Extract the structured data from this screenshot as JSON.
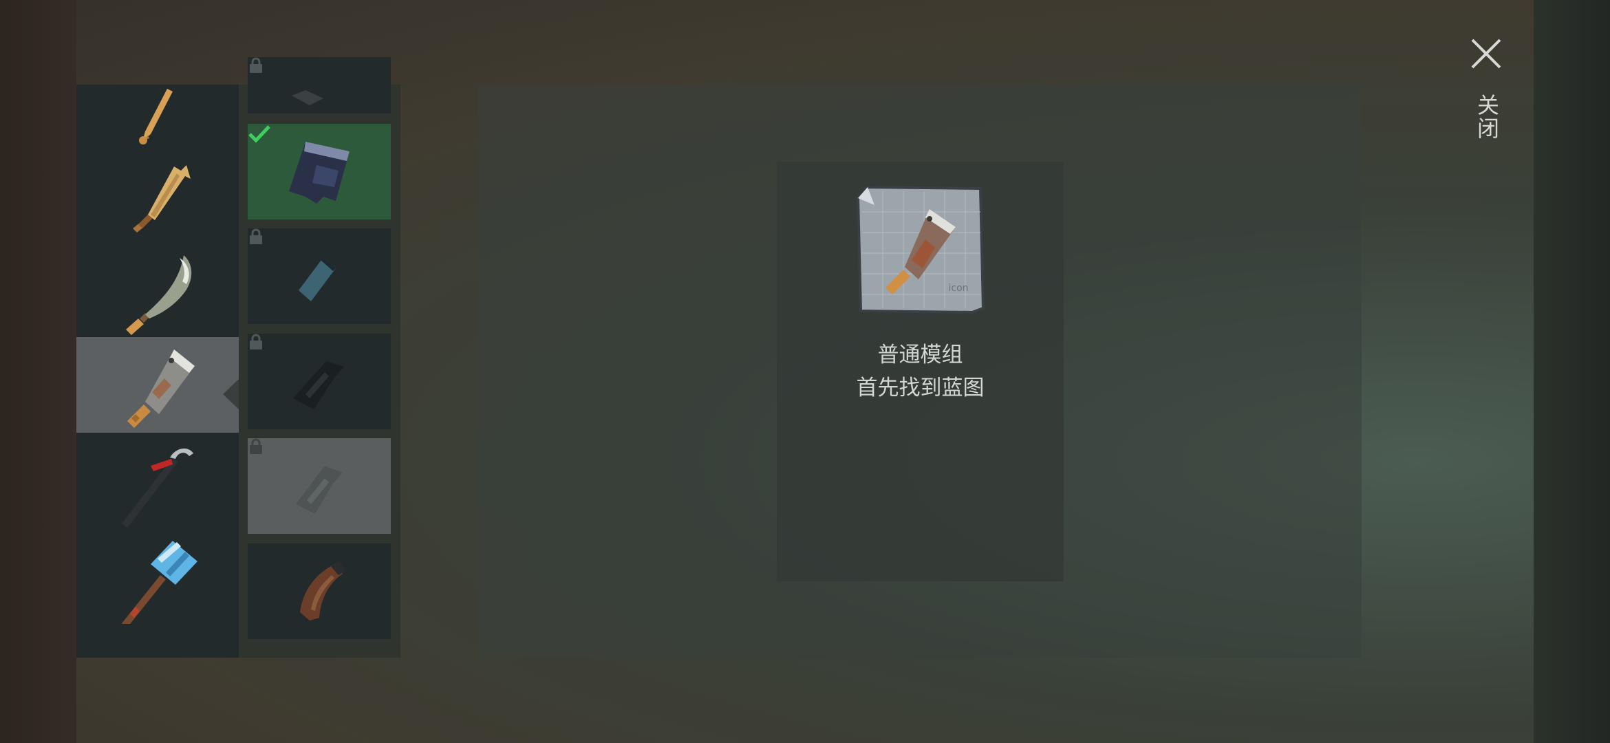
{
  "screen": {
    "close_label": "关闭"
  },
  "weapons": {
    "items": [
      {
        "icon": "bat-icon",
        "state": "partial"
      },
      {
        "icon": "wooden-paddle-icon",
        "state": "normal"
      },
      {
        "icon": "machete-icon",
        "state": "normal"
      },
      {
        "icon": "cleaver-icon",
        "state": "selected"
      },
      {
        "icon": "crowbar-icon",
        "state": "normal"
      },
      {
        "icon": "sledgehammer-icon",
        "state": "normal"
      }
    ]
  },
  "mods": {
    "slots": [
      {
        "icon": "mod-part-icon",
        "state": "locked"
      },
      {
        "icon": "cleaver-blade-mod-icon",
        "state": "equipped"
      },
      {
        "icon": "tape-wrap-mod-icon",
        "state": "locked"
      },
      {
        "icon": "black-grip-mod-icon",
        "state": "locked"
      },
      {
        "icon": "grey-grip-mod-icon",
        "state": "locked"
      },
      {
        "icon": "wooden-handle-mod-icon",
        "state": "available"
      }
    ]
  },
  "detail": {
    "icon": "cleaver-blueprint-icon",
    "blueprint_stamp": "icon",
    "title": "普通模组",
    "hint": "首先找到蓝图"
  },
  "colors": {
    "equipped_green": "#2c5a3b",
    "check_green": "#3fcf5f",
    "selected_grey": "#5c6062",
    "slot_dark": "#232a2c"
  }
}
